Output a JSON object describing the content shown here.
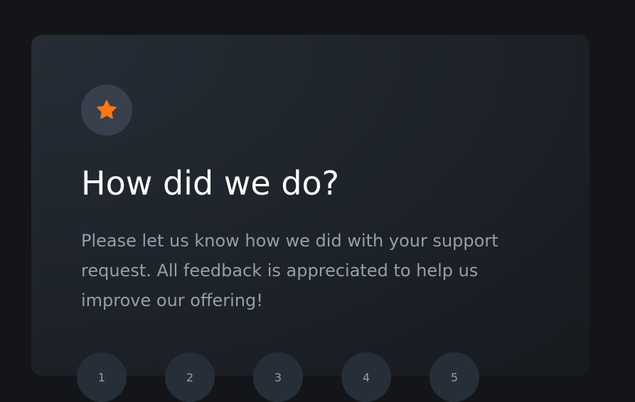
{
  "card": {
    "icon": "star-icon",
    "title": "How did we do?",
    "description": "Please let us know how we did with your support request. All feedback is appreciated to help us improve our offering!",
    "ratings": [
      "1",
      "2",
      "3",
      "4",
      "5"
    ]
  },
  "colors": {
    "page_background": "#131518",
    "card_background": "#1e232a",
    "badge_background": "#383f4d",
    "accent": "#fc7614",
    "title": "#ffffff",
    "body_text": "#959eab"
  }
}
